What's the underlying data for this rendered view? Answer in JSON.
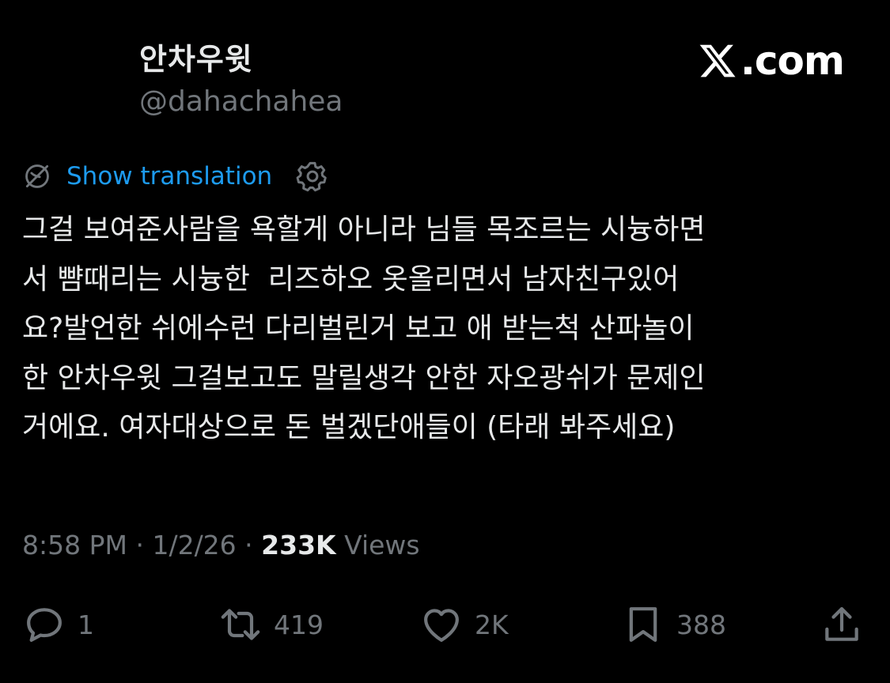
{
  "author": {
    "display_name": "안차우윗",
    "handle": "@dahachahea"
  },
  "brand": {
    "label": ".com",
    "icon": "x-logo-icon"
  },
  "translation": {
    "label": "Show translation",
    "icon": "translate-globe-icon",
    "settings_icon": "gear-icon",
    "link_color": "#1d9bf0"
  },
  "tweet": {
    "lines": [
      "그걸 보여준사람을 욕할게 아니라 님들 목조르는 시늉하면",
      "서 뺨때리는 시늉한  리즈하오 옷올리면서 남자친구있어",
      "요?발언한 쉬에수런 다리벌린거 보고 애 받는척 산파놀이",
      "한 안차우윗 그걸보고도 말릴생각 안한 자오광쉬가 문제인",
      "거에요. 여자대상으로 돈 벌겠단애들이 (타래 봐주세요)"
    ]
  },
  "meta": {
    "time": "8:58 PM",
    "sep1": " · ",
    "date": "1/2/26",
    "sep2": " · ",
    "views_count": "233K",
    "views_label": " Views"
  },
  "actions": {
    "reply": {
      "icon": "reply-icon",
      "count": "1"
    },
    "repost": {
      "icon": "repost-icon",
      "count": "419"
    },
    "like": {
      "icon": "heart-icon",
      "count": "2K"
    },
    "bookmark": {
      "icon": "bookmark-icon",
      "count": "388"
    },
    "share": {
      "icon": "share-icon"
    }
  },
  "colors": {
    "background": "#000000",
    "text": "#e7e9ea",
    "secondary": "#71767b",
    "accent": "#1d9bf0"
  }
}
